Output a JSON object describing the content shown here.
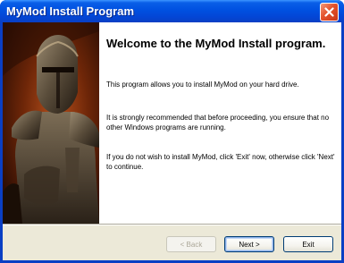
{
  "window": {
    "title": "MyMod Install Program"
  },
  "content": {
    "heading": "Welcome to the MyMod Install program.",
    "paragraphs": [
      "This program allows you to install MyMod on your hard drive.",
      "It is strongly recommended that before proceeding, you ensure that no other Windows programs are running.",
      "If you do not wish to install MyMod, click 'Exit' now, otherwise click 'Next' to continue."
    ]
  },
  "buttons": {
    "back": "< Back",
    "next": "Next >",
    "exit": "Exit"
  },
  "icons": {
    "close": "close-icon",
    "hero": "armored-warrior-image"
  },
  "colors": {
    "titlebar": "#0a5fe8",
    "close_button": "#e4522b",
    "dialog_background": "#ece9d8",
    "content_background": "#ffffff",
    "button_border": "#003c74"
  }
}
